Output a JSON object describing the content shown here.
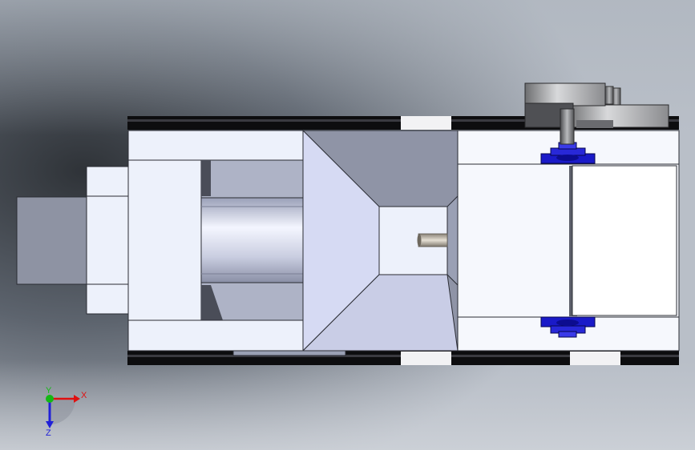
{
  "viewport": {
    "background_colors": [
      "#3a3f47",
      "#8b929c",
      "#c4c9d1"
    ]
  },
  "model": {
    "colors": {
      "frame_rail": "#0d0d0f",
      "body_light": "#edf1fb",
      "body_mid": "#c9cede",
      "body_dark": "#8f94a6",
      "funnel_face": "#d6daf3",
      "bearing": "#1a1ac8",
      "pulley": "#b7b8bb"
    }
  },
  "triad": {
    "x_label": "X",
    "y_label": "Y",
    "z_label": "Z",
    "colors": {
      "x": "#e01010",
      "y": "#14b814",
      "z": "#2020d8"
    }
  }
}
